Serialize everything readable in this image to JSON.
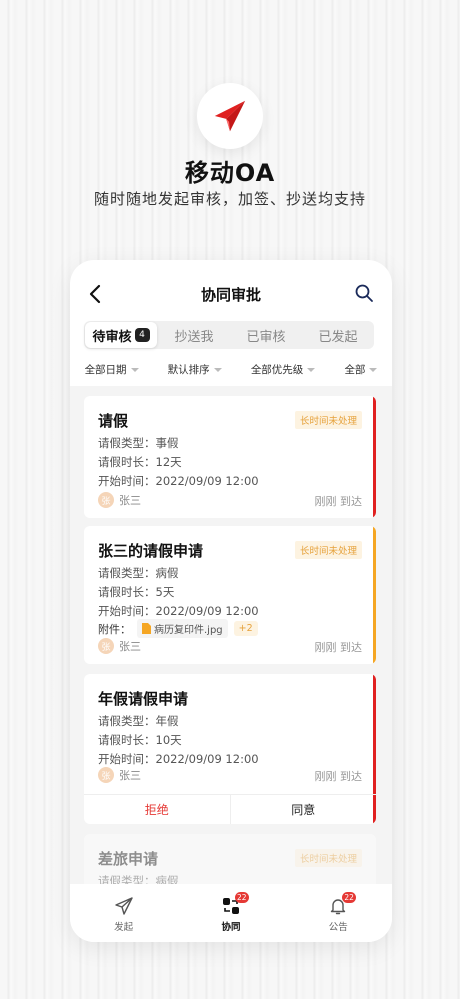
{
  "hero": {
    "title": "移动OA",
    "subtitle": "随时随地发起审核，加签、抄送均支持",
    "icon": "paper-plane-icon",
    "brand_color": "#e02020"
  },
  "screen": {
    "nav": {
      "title": "协同审批",
      "back_icon": "chevron-left-icon",
      "search_icon": "search-icon"
    },
    "tabs": [
      {
        "label": "待审核",
        "count": "4",
        "active": true
      },
      {
        "label": "抄送我"
      },
      {
        "label": "已审核"
      },
      {
        "label": "已发起"
      }
    ],
    "filters": [
      {
        "label": "全部日期"
      },
      {
        "label": "默认排序"
      },
      {
        "label": "全部优先级"
      },
      {
        "label": "全部"
      }
    ],
    "cards": [
      {
        "title": "请假",
        "tag": "长时间未处理",
        "bar_color": "#e02020",
        "fields": [
          "请假类型：事假",
          "请假时长：12天",
          "开始时间：2022/09/09 12:00"
        ],
        "avatar_initial": "张",
        "user": "张三",
        "time": "刚刚 到达"
      },
      {
        "title": "张三的请假申请",
        "tag": "长时间未处理",
        "bar_color": "#f5a623",
        "fields": [
          "请假类型：病假",
          "请假时长：5天",
          "开始时间：2022/09/09 12:00"
        ],
        "attachment": {
          "label": "附件：",
          "file": "病历复印件.jpg",
          "more": "+2"
        },
        "avatar_initial": "张",
        "user": "张三",
        "time": "刚刚 到达"
      },
      {
        "title": "年假请假申请",
        "bar_color": "#e02020",
        "fields": [
          "请假类型：年假",
          "请假时长：10天",
          "开始时间：2022/09/09 12:00"
        ],
        "avatar_initial": "张",
        "user": "张三",
        "time": "刚刚 到达",
        "actions": {
          "reject": "拒绝",
          "agree": "同意"
        }
      },
      {
        "title": "差旅申请",
        "tag": "长时间未处理",
        "fields": [
          "请假类型：病假"
        ]
      }
    ],
    "tabbar": [
      {
        "label": "发起",
        "icon": "send-icon"
      },
      {
        "label": "协同",
        "icon": "collaborate-icon",
        "badge": "22",
        "active": true
      },
      {
        "label": "公告",
        "icon": "bell-icon",
        "badge": "22"
      }
    ]
  }
}
